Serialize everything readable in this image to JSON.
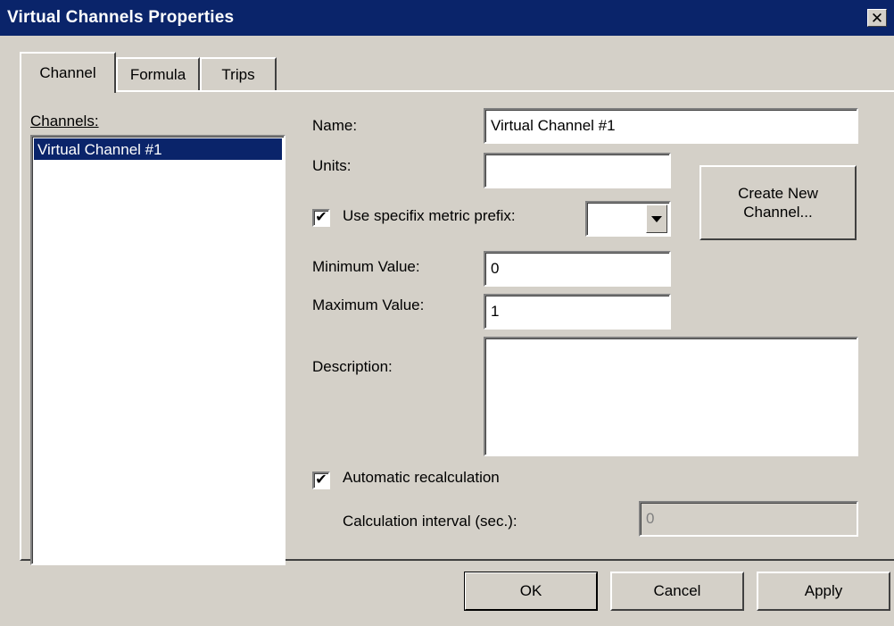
{
  "window": {
    "title": "Virtual Channels Properties",
    "close_glyph": "✕"
  },
  "tabs": [
    {
      "label": "Channel",
      "active": true
    },
    {
      "label": "Formula",
      "active": false
    },
    {
      "label": "Trips",
      "active": false
    }
  ],
  "channels": {
    "label": "Channels:",
    "items": [
      "Virtual Channel #1"
    ],
    "selected": "Virtual Channel #1"
  },
  "name": {
    "label": "Name:",
    "value": "Virtual Channel #1"
  },
  "units": {
    "label": "Units:",
    "value": ""
  },
  "metric_prefix": {
    "checkbox_label": "Use specifix metric prefix:",
    "checked": true,
    "check_glyph": "✔",
    "selected_value": ""
  },
  "create_button": {
    "line1": "Create New",
    "line2": "Channel..."
  },
  "minimum": {
    "label": "Minimum Value:",
    "value": "0"
  },
  "maximum": {
    "label": "Maximum Value:",
    "value": "1"
  },
  "description": {
    "label": "Description:",
    "value": ""
  },
  "auto_recalc": {
    "label": "Automatic recalculation",
    "checked": true,
    "check_glyph": "✔"
  },
  "interval": {
    "label": "Calculation interval (sec.):",
    "value": "0"
  },
  "footer": {
    "ok_label": "OK",
    "cancel_label": "Cancel",
    "apply_label": "Apply"
  },
  "colors": {
    "titlebar": "#0a246a",
    "dialog_face": "#d4d0c8",
    "selection": "#0a246a"
  }
}
